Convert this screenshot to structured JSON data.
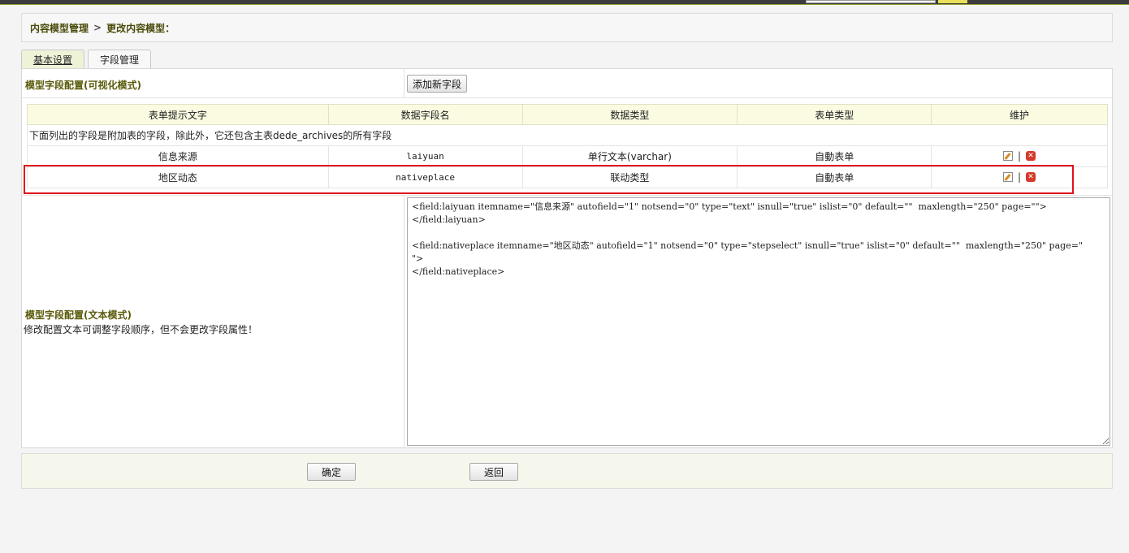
{
  "breadcrumb": {
    "parent": "内容模型管理",
    "separator": ">",
    "current": "更改内容模型："
  },
  "tabs": [
    {
      "label": "基本设置",
      "active": true
    },
    {
      "label": "字段管理",
      "active": false
    }
  ],
  "visual_section": {
    "label": "模型字段配置(可视化模式)",
    "add_button": "添加新字段"
  },
  "table": {
    "headers": [
      "表单提示文字",
      "数据字段名",
      "数据类型",
      "表单类型",
      "维护"
    ],
    "note": "下面列出的字段是附加表的字段，除此外，它还包含主表dede_archives的所有字段",
    "rows": [
      {
        "label": "信息来源",
        "field": "laiyuan",
        "dtype": "单行文本(varchar)",
        "ftype": "自動表单"
      },
      {
        "label": "地区动态",
        "field": "nativeplace",
        "dtype": "联动类型",
        "ftype": "自動表单"
      }
    ],
    "op_separator": "|"
  },
  "text_section": {
    "label": "模型字段配置(文本模式)",
    "hint": "修改配置文本可调整字段顺序，但不会更改字段属性！",
    "config_text": "<field:laiyuan itemname=\"信息来源\" autofield=\"1\" notsend=\"0\" type=\"text\" isnull=\"true\" islist=\"0\" default=\"\"  maxlength=\"250\" page=\"\">\n</field:laiyuan>\n\n<field:nativeplace itemname=\"地区动态\" autofield=\"1\" notsend=\"0\" type=\"stepselect\" isnull=\"true\" islist=\"0\" default=\"\"  maxlength=\"250\" page=\"\n\">\n</field:nativeplace>"
  },
  "footer": {
    "ok_label": "确定",
    "back_label": "返回"
  },
  "colors": {
    "label_text": "#5a5a0a",
    "header_bg": "#fbfbe2",
    "highlight_border": "#e0101a"
  }
}
